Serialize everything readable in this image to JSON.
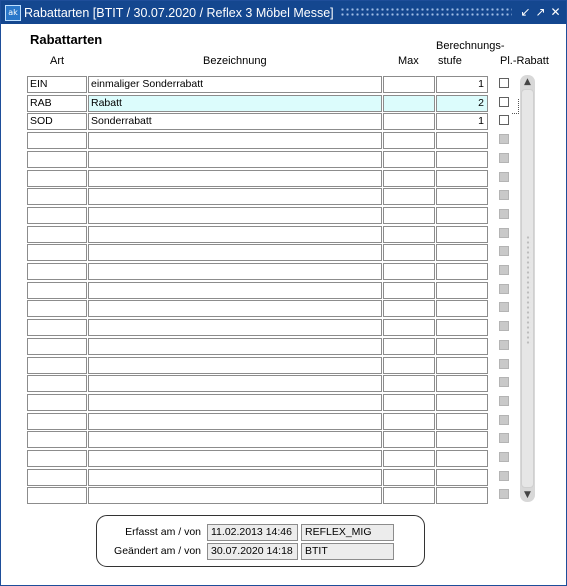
{
  "window": {
    "title": "Rabattarten   [BTIT / 30.07.2020 / Reflex 3 Möbel Messe]",
    "icon": "app-icon",
    "controls": [
      "minimize-icon",
      "restore-icon",
      "close-icon"
    ]
  },
  "section_title": "Rabattarten",
  "headers": {
    "art": "Art",
    "bezeichnung": "Bezeichnung",
    "max": "Max",
    "berechnungsstufe_line1": "Berechnungs-",
    "berechnungsstufe_line2": "stufe",
    "pl_rabatt": "Pl.-Rabatt"
  },
  "rows": [
    {
      "art": "EIN",
      "bezeichnung": "einmaliger Sonderrabatt",
      "max": "",
      "stufe": "1",
      "pl_rabatt": false,
      "active": true,
      "selected": false
    },
    {
      "art": "RAB",
      "bezeichnung": "Rabatt",
      "max": "",
      "stufe": "2",
      "pl_rabatt": false,
      "active": true,
      "selected": true
    },
    {
      "art": "SOD",
      "bezeichnung": "Sonderrabatt",
      "max": "",
      "stufe": "1",
      "pl_rabatt": false,
      "active": true,
      "selected": false
    },
    {
      "art": "",
      "bezeichnung": "",
      "max": "",
      "stufe": "",
      "pl_rabatt": false,
      "active": false,
      "selected": false
    },
    {
      "art": "",
      "bezeichnung": "",
      "max": "",
      "stufe": "",
      "pl_rabatt": false,
      "active": false,
      "selected": false
    },
    {
      "art": "",
      "bezeichnung": "",
      "max": "",
      "stufe": "",
      "pl_rabatt": false,
      "active": false,
      "selected": false
    },
    {
      "art": "",
      "bezeichnung": "",
      "max": "",
      "stufe": "",
      "pl_rabatt": false,
      "active": false,
      "selected": false
    },
    {
      "art": "",
      "bezeichnung": "",
      "max": "",
      "stufe": "",
      "pl_rabatt": false,
      "active": false,
      "selected": false
    },
    {
      "art": "",
      "bezeichnung": "",
      "max": "",
      "stufe": "",
      "pl_rabatt": false,
      "active": false,
      "selected": false
    },
    {
      "art": "",
      "bezeichnung": "",
      "max": "",
      "stufe": "",
      "pl_rabatt": false,
      "active": false,
      "selected": false
    },
    {
      "art": "",
      "bezeichnung": "",
      "max": "",
      "stufe": "",
      "pl_rabatt": false,
      "active": false,
      "selected": false
    },
    {
      "art": "",
      "bezeichnung": "",
      "max": "",
      "stufe": "",
      "pl_rabatt": false,
      "active": false,
      "selected": false
    },
    {
      "art": "",
      "bezeichnung": "",
      "max": "",
      "stufe": "",
      "pl_rabatt": false,
      "active": false,
      "selected": false
    },
    {
      "art": "",
      "bezeichnung": "",
      "max": "",
      "stufe": "",
      "pl_rabatt": false,
      "active": false,
      "selected": false
    },
    {
      "art": "",
      "bezeichnung": "",
      "max": "",
      "stufe": "",
      "pl_rabatt": false,
      "active": false,
      "selected": false
    },
    {
      "art": "",
      "bezeichnung": "",
      "max": "",
      "stufe": "",
      "pl_rabatt": false,
      "active": false,
      "selected": false
    },
    {
      "art": "",
      "bezeichnung": "",
      "max": "",
      "stufe": "",
      "pl_rabatt": false,
      "active": false,
      "selected": false
    },
    {
      "art": "",
      "bezeichnung": "",
      "max": "",
      "stufe": "",
      "pl_rabatt": false,
      "active": false,
      "selected": false
    },
    {
      "art": "",
      "bezeichnung": "",
      "max": "",
      "stufe": "",
      "pl_rabatt": false,
      "active": false,
      "selected": false
    },
    {
      "art": "",
      "bezeichnung": "",
      "max": "",
      "stufe": "",
      "pl_rabatt": false,
      "active": false,
      "selected": false
    },
    {
      "art": "",
      "bezeichnung": "",
      "max": "",
      "stufe": "",
      "pl_rabatt": false,
      "active": false,
      "selected": false
    },
    {
      "art": "",
      "bezeichnung": "",
      "max": "",
      "stufe": "",
      "pl_rabatt": false,
      "active": false,
      "selected": false
    },
    {
      "art": "",
      "bezeichnung": "",
      "max": "",
      "stufe": "",
      "pl_rabatt": false,
      "active": false,
      "selected": false
    }
  ],
  "info": {
    "erfasst_label": "Erfasst am / von",
    "erfasst_date": "11.02.2013 14:46",
    "erfasst_user": "REFLEX_MIG",
    "geaendert_label": "Geändert am / von",
    "geaendert_date": "30.07.2020 14:18",
    "geaendert_user": "BTIT"
  },
  "colors": {
    "titlebar": "#14478f",
    "selected_row": "#dcfcfc"
  }
}
